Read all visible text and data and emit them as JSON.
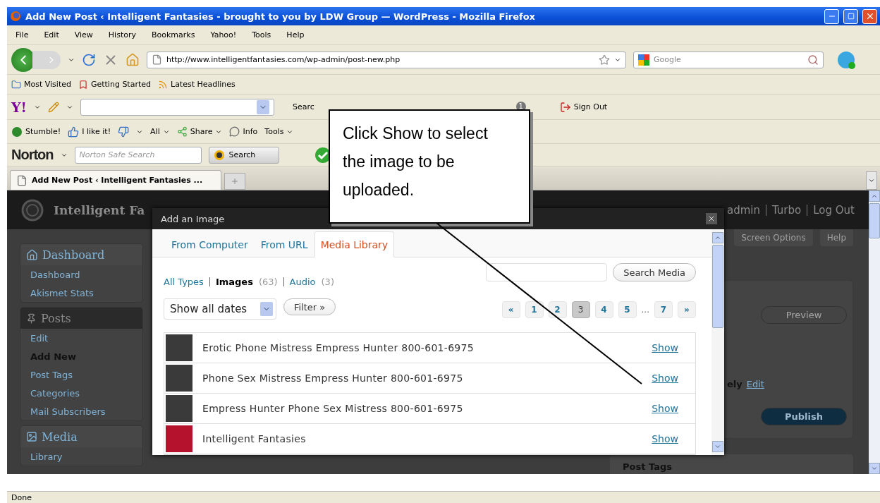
{
  "window": {
    "title": "Add New Post ‹ Intelligent Fantasies - brought to you by LDW Group — WordPress - Mozilla Firefox"
  },
  "menu": [
    "File",
    "Edit",
    "View",
    "History",
    "Bookmarks",
    "Yahoo!",
    "Tools",
    "Help"
  ],
  "navigation": {
    "url": "http://www.intelligentfantasies.com/wp-admin/post-new.php",
    "search_placeholder": "Google"
  },
  "bookmarks": [
    {
      "label": "Most Visited",
      "kind": "folder"
    },
    {
      "label": "Getting Started",
      "kind": "page"
    },
    {
      "label": "Latest Headlines",
      "kind": "feed"
    }
  ],
  "yahoo_toolbar": {
    "logo": "Y!",
    "search_label": "Searc",
    "mail_badge": "1",
    "sign_out": "Sign Out"
  },
  "stumble_toolbar": {
    "stumble": "Stumble!",
    "like": "I like it!",
    "all": "All",
    "share": "Share",
    "info": "Info",
    "tools": "Tools"
  },
  "norton": {
    "logo": "Norton",
    "placeholder": "Norton Safe Search",
    "search_button": "Search"
  },
  "tabs": [
    {
      "label": "Add New Post ‹ Intelligent Fantasies ...",
      "selected": true
    }
  ],
  "wordpress": {
    "site_title": "Intelligent Fa",
    "user_links": [
      "admin",
      "Turbo",
      "Log Out"
    ],
    "screen_tabs": [
      "Screen Options",
      "Help"
    ],
    "sidebar": [
      {
        "label": "Dashboard",
        "kind": "dashboard",
        "selected": false,
        "items": [
          {
            "label": "Dashboard",
            "selected": false
          },
          {
            "label": "Akismet Stats",
            "selected": false
          }
        ]
      },
      {
        "label": "Posts",
        "kind": "posts",
        "selected": true,
        "items": [
          {
            "label": "Edit",
            "selected": false
          },
          {
            "label": "Add New",
            "selected": true
          },
          {
            "label": "Post Tags",
            "selected": false
          },
          {
            "label": "Categories",
            "selected": false
          },
          {
            "label": "Mail Subscribers",
            "selected": false
          }
        ]
      },
      {
        "label": "Media",
        "kind": "media",
        "selected": false,
        "items": [
          {
            "label": "Library",
            "selected": false
          }
        ]
      }
    ],
    "publish_box": {
      "preview": "Preview",
      "status_text": "ely",
      "edit_link": "Edit",
      "publish": "Publish"
    },
    "post_tags": "Post Tags"
  },
  "dialog": {
    "title": "Add an Image",
    "tabs": [
      {
        "label": "From Computer",
        "selected": false
      },
      {
        "label": "From URL",
        "selected": false
      },
      {
        "label": "Media Library",
        "selected": true
      }
    ],
    "type_filters": [
      {
        "label": "All Types",
        "selected": false
      },
      {
        "label": "Images",
        "count": "(63)",
        "selected": true
      },
      {
        "label": "Audio",
        "count": "(3)",
        "selected": false
      }
    ],
    "search_button": "Search Media",
    "date_filter": "Show all dates",
    "filter_button": "Filter »",
    "pagination": [
      {
        "label": "«",
        "kind": "page",
        "selected": false
      },
      {
        "label": "1",
        "kind": "page",
        "selected": false
      },
      {
        "label": "2",
        "kind": "page",
        "selected": false
      },
      {
        "label": "3",
        "kind": "page",
        "selected": true
      },
      {
        "label": "4",
        "kind": "page",
        "selected": false
      },
      {
        "label": "5",
        "kind": "page",
        "selected": false
      },
      {
        "label": "...",
        "kind": "gap"
      },
      {
        "label": "7",
        "kind": "page",
        "selected": false
      },
      {
        "label": "»",
        "kind": "page",
        "selected": false
      }
    ],
    "media": [
      {
        "title": "Erotic Phone Mistress Empress Hunter 800-601-6975",
        "action": "Show",
        "kind": "photo"
      },
      {
        "title": "Phone Sex Mistress Empress Hunter 800-601-6975",
        "action": "Show",
        "kind": "photo"
      },
      {
        "title": "Empress Hunter Phone Sex Mistress 800-601-6975",
        "action": "Show",
        "kind": "photo"
      },
      {
        "title": "Intelligent Fantasies",
        "action": "Show",
        "kind": "banner"
      }
    ]
  },
  "callout": {
    "text": "Click Show to select the image to be uploaded."
  },
  "status_bar": {
    "text": "Done"
  }
}
